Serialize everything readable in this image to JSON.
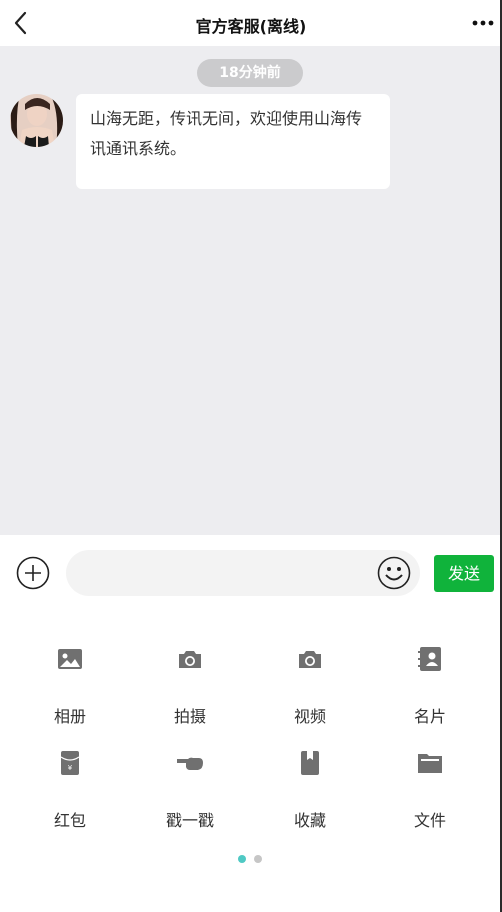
{
  "header": {
    "title": "官方客服(离线)",
    "back_icon": "chevron-left-icon",
    "more_icon": "more-dots-icon"
  },
  "chat": {
    "timestamp": "18分钟前",
    "messages": [
      {
        "text": "山海无距，传讯无间，欢迎使用山海传讯通讯系统。"
      }
    ]
  },
  "input_bar": {
    "plus_icon": "plus-circle-icon",
    "placeholder": "",
    "emoji_icon": "emoji-icon",
    "send_label": "发送"
  },
  "panel": {
    "items": [
      {
        "label": "相册",
        "icon": "image-icon"
      },
      {
        "label": "拍摄",
        "icon": "camera-icon"
      },
      {
        "label": "视频",
        "icon": "video-camera-icon"
      },
      {
        "label": "名片",
        "icon": "contact-card-icon"
      },
      {
        "label": "红包",
        "icon": "red-packet-icon"
      },
      {
        "label": "戳一戳",
        "icon": "poke-hand-icon"
      },
      {
        "label": "收藏",
        "icon": "bookmark-icon"
      },
      {
        "label": "文件",
        "icon": "folder-icon"
      }
    ],
    "page_indicator": {
      "current": 1,
      "total": 2
    }
  },
  "colors": {
    "chat_bg": "#ededf0",
    "send_button": "#10b33b",
    "icon_gray": "#707070",
    "active_dot": "#4fc9c4",
    "inactive_dot": "#c6c6c6"
  }
}
